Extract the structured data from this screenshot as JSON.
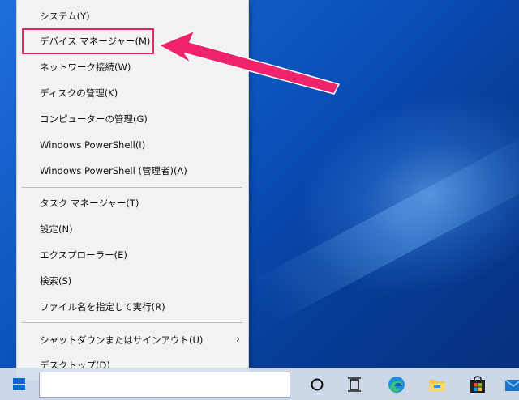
{
  "context_menu": {
    "items": [
      {
        "label": "システム(Y)"
      },
      {
        "label": "デバイス マネージャー(M)"
      },
      {
        "label": "ネットワーク接続(W)"
      },
      {
        "label": "ディスクの管理(K)"
      },
      {
        "label": "コンピューターの管理(G)"
      },
      {
        "label": "Windows PowerShell(I)"
      },
      {
        "label": "Windows PowerShell (管理者)(A)"
      },
      {
        "label": "タスク マネージャー(T)"
      },
      {
        "label": "設定(N)"
      },
      {
        "label": "エクスプローラー(E)"
      },
      {
        "label": "検索(S)"
      },
      {
        "label": "ファイル名を指定して実行(R)"
      },
      {
        "label": "シャットダウンまたはサインアウト(U)"
      },
      {
        "label": "デスクトップ(D)"
      }
    ],
    "submenu_arrow": "›"
  },
  "taskbar": {
    "icons": [
      "windows-start-icon",
      "search-box",
      "cortana-circle-icon",
      "task-view-icon",
      "edge-icon",
      "file-explorer-icon",
      "microsoft-store-icon",
      "mail-icon"
    ]
  },
  "colors": {
    "highlight": "#e8256c",
    "desktop_blue": "#0a4fb8"
  }
}
